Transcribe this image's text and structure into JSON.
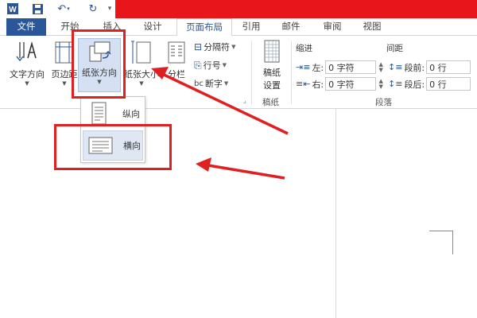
{
  "quick_access": {
    "app_icon": "word-icon",
    "save_icon": "save-icon",
    "undo_icon": "undo-icon",
    "redo_icon": "redo-icon",
    "more_icon": "customize-qat-icon"
  },
  "tabs": {
    "file": "文件",
    "home": "开始",
    "insert": "插入",
    "design": "设计",
    "layout": "页面布局",
    "references": "引用",
    "mailings": "邮件",
    "review": "审阅",
    "view": "视图"
  },
  "page_setup": {
    "text_direction": "文字方向",
    "margins": "页边距",
    "orientation": "纸张方向",
    "size": "纸张大小",
    "columns": "分栏",
    "breaks": "分隔符",
    "line_numbers": "行号",
    "hyphenation": "断字"
  },
  "manuscript": {
    "button_line1": "稿纸",
    "button_line2": "设置",
    "group_label": "稿纸"
  },
  "paragraph": {
    "indent_header": "缩进",
    "spacing_header": "间距",
    "left_label": "左:",
    "left_value": "0 字符",
    "right_label": "右:",
    "right_value": "0 字符",
    "before_label": "段前:",
    "before_value": "0 行",
    "after_label": "段后:",
    "after_value": "0 行",
    "group_label": "段落"
  },
  "orientation_menu": {
    "portrait": "纵向",
    "landscape": "横向",
    "selected": "landscape"
  },
  "colors": {
    "accent_blue": "#2b579a",
    "title_red": "#e8161b",
    "annotation_red": "#e02020"
  }
}
